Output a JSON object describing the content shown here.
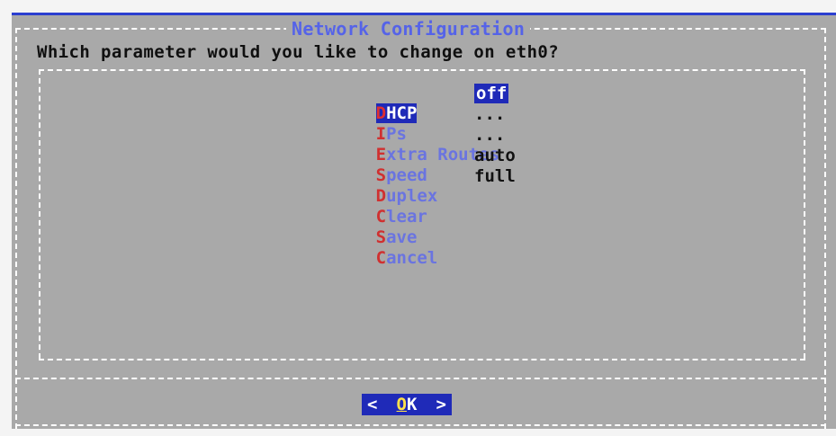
{
  "dialog": {
    "title": "Network Configuration",
    "question": "Which parameter would you like to change on eth0?"
  },
  "menu": {
    "items": [
      {
        "hotkey": "D",
        "rest": "HCP",
        "value": "off",
        "selected": true
      },
      {
        "hotkey": "I",
        "rest": "Ps",
        "value": "...",
        "selected": false
      },
      {
        "hotkey": "E",
        "rest": "xtra Routes",
        "value": "...",
        "selected": false
      },
      {
        "hotkey": "S",
        "rest": "peed",
        "value": "auto",
        "selected": false
      },
      {
        "hotkey": "D",
        "rest": "uplex",
        "value": "full",
        "selected": false
      },
      {
        "hotkey": "C",
        "rest": "lear",
        "value": "",
        "selected": false
      },
      {
        "hotkey": "S",
        "rest": "ave",
        "value": "",
        "selected": false
      },
      {
        "hotkey": "C",
        "rest": "ancel",
        "value": "",
        "selected": false
      }
    ]
  },
  "buttons": {
    "ok_left": "<",
    "ok_hot": "O",
    "ok_rest": "K",
    "ok_right": ">"
  },
  "colors": {
    "background": "#a9a9a9",
    "accent": "#1f2ab8",
    "title": "#5563e8",
    "hotkey": "#d03030"
  }
}
